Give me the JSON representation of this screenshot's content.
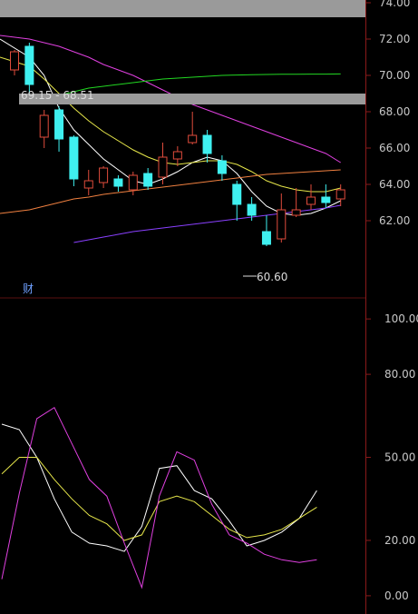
{
  "colors": {
    "background": "#000000",
    "axis_line": "#8a1a1a",
    "tick_text": "#c8c8c8",
    "up_candle": "#e04c3c",
    "down_candle": "#3ff0f0",
    "ma_white": "#ffffff",
    "ma_yellow": "#e6e64a",
    "ma_magenta": "#e040e0",
    "ma_green": "#22d822",
    "ma_orange": "#f08040",
    "ma_purple": "#8a40ff",
    "banner": "#9a9a9a",
    "kdj_k": "#ffffff",
    "kdj_d": "#e6e64a",
    "kdj_j": "#e040e0"
  },
  "chart_data": [
    {
      "type": "candlestick",
      "ylim": [
        60.5,
        74
      ],
      "y_ticks": [
        "62.00",
        "64.00",
        "66.00",
        "68.00",
        "70.00",
        "72.00",
        "74.00"
      ],
      "range_label": "69.15 - 68.51",
      "low_label": "60.60",
      "marker_label": "财",
      "banners": [
        {
          "y_top": 74.2,
          "y_bottom": 73.2
        },
        {
          "y_top": 69.0,
          "y_bottom": 68.4
        }
      ],
      "candles": [
        {
          "o": 70.3,
          "c": 71.3,
          "h": 71.4,
          "l": 70.0
        },
        {
          "o": 71.6,
          "c": 69.5,
          "h": 71.8,
          "l": 69.0
        },
        {
          "o": 66.6,
          "c": 67.8,
          "h": 68.1,
          "l": 66.0
        },
        {
          "o": 68.1,
          "c": 66.5,
          "h": 68.3,
          "l": 65.8
        },
        {
          "o": 66.6,
          "c": 64.3,
          "h": 66.7,
          "l": 63.9
        },
        {
          "o": 63.8,
          "c": 64.2,
          "h": 64.8,
          "l": 63.4
        },
        {
          "o": 64.1,
          "c": 64.9,
          "h": 65.0,
          "l": 63.8
        },
        {
          "o": 64.3,
          "c": 63.9,
          "h": 64.5,
          "l": 63.6
        },
        {
          "o": 63.7,
          "c": 64.5,
          "h": 64.7,
          "l": 63.4
        },
        {
          "o": 64.6,
          "c": 63.9,
          "h": 64.9,
          "l": 63.7
        },
        {
          "o": 64.4,
          "c": 65.5,
          "h": 66.3,
          "l": 64.0
        },
        {
          "o": 65.4,
          "c": 65.8,
          "h": 66.1,
          "l": 65.0
        },
        {
          "o": 66.3,
          "c": 66.7,
          "h": 68.0,
          "l": 66.2
        },
        {
          "o": 66.7,
          "c": 65.7,
          "h": 67.0,
          "l": 65.2
        },
        {
          "o": 65.3,
          "c": 64.6,
          "h": 65.6,
          "l": 64.2
        },
        {
          "o": 64.0,
          "c": 62.9,
          "h": 64.2,
          "l": 62.0
        },
        {
          "o": 62.9,
          "c": 62.3,
          "h": 63.3,
          "l": 62.0
        },
        {
          "o": 61.4,
          "c": 60.7,
          "h": 62.3,
          "l": 60.6
        },
        {
          "o": 61.0,
          "c": 62.6,
          "h": 63.5,
          "l": 60.8
        },
        {
          "o": 62.3,
          "c": 62.6,
          "h": 63.8,
          "l": 62.2
        },
        {
          "o": 62.9,
          "c": 63.3,
          "h": 64.0,
          "l": 62.6
        },
        {
          "o": 63.3,
          "c": 63.0,
          "h": 64.0,
          "l": 62.7
        },
        {
          "o": 63.2,
          "c": 63.7,
          "h": 64.0,
          "l": 62.8
        }
      ],
      "moving_averages": [
        {
          "color_key": "ma_white",
          "values": [
            72.0,
            71.0,
            70.0,
            68.2,
            67.0,
            66.2,
            65.4,
            64.8,
            64.2,
            64.0,
            64.3,
            64.7,
            65.2,
            65.5,
            65.3,
            64.6,
            63.6,
            62.8,
            62.4,
            62.3,
            62.4,
            62.7,
            63.1
          ]
        },
        {
          "color_key": "ma_yellow",
          "values": [
            71.0,
            70.5,
            69.8,
            69.0,
            68.2,
            67.5,
            66.9,
            66.4,
            65.9,
            65.5,
            65.2,
            65.1,
            65.2,
            65.3,
            65.3,
            65.1,
            64.7,
            64.2,
            63.9,
            63.7,
            63.6,
            63.6,
            63.8
          ]
        },
        {
          "color_key": "ma_magenta",
          "values": [
            72.2,
            72.0,
            71.8,
            71.6,
            71.3,
            71.0,
            70.6,
            70.3,
            70.0,
            69.6,
            69.2,
            68.8,
            68.4,
            68.1,
            67.8,
            67.5,
            67.2,
            66.9,
            66.6,
            66.3,
            66.0,
            65.7,
            65.2
          ]
        },
        {
          "color_key": "ma_green",
          "values": [
            null,
            68.6,
            68.7,
            68.9,
            69.1,
            69.3,
            69.4,
            69.5,
            69.6,
            69.7,
            69.8,
            69.85,
            69.9,
            69.95,
            70.0,
            70.02,
            70.04,
            70.05,
            70.06,
            70.06,
            70.07,
            70.07,
            70.08
          ]
        },
        {
          "color_key": "ma_orange",
          "values": [
            62.4,
            62.6,
            62.8,
            63.0,
            63.2,
            63.3,
            63.45,
            63.55,
            63.65,
            63.75,
            63.85,
            63.95,
            64.05,
            64.15,
            64.25,
            64.35,
            64.45,
            64.55,
            64.6,
            64.65,
            64.7,
            64.75,
            64.8
          ]
        },
        {
          "color_key": "ma_purple",
          "values": [
            null,
            null,
            null,
            null,
            60.8,
            60.95,
            61.1,
            61.25,
            61.4,
            61.5,
            61.6,
            61.7,
            61.8,
            61.9,
            62.0,
            62.1,
            62.2,
            62.3,
            62.4,
            62.5,
            62.6,
            62.7,
            62.85
          ]
        }
      ]
    },
    {
      "type": "line",
      "ylim": [
        -2,
        103
      ],
      "y_ticks": [
        "0.00",
        "20.00",
        "50.00",
        "80.00",
        "100.00"
      ],
      "y_tick_values": [
        0,
        20,
        50,
        80,
        100
      ],
      "series": [
        {
          "color_key": "kdj_k",
          "values": [
            62,
            60,
            50,
            35,
            23,
            19,
            18,
            16,
            25,
            46,
            47,
            38,
            35,
            27,
            18,
            20,
            23,
            28,
            38
          ]
        },
        {
          "color_key": "kdj_d",
          "values": [
            44,
            50,
            50,
            42,
            35,
            29,
            26,
            20,
            22,
            34,
            36,
            34,
            29,
            24,
            21,
            22,
            24,
            28,
            32
          ]
        },
        {
          "color_key": "kdj_j",
          "values": [
            6,
            37,
            64,
            68,
            55,
            42,
            36,
            19,
            3,
            36,
            52,
            49,
            33,
            22,
            19,
            15,
            13,
            12,
            13
          ]
        }
      ]
    }
  ]
}
